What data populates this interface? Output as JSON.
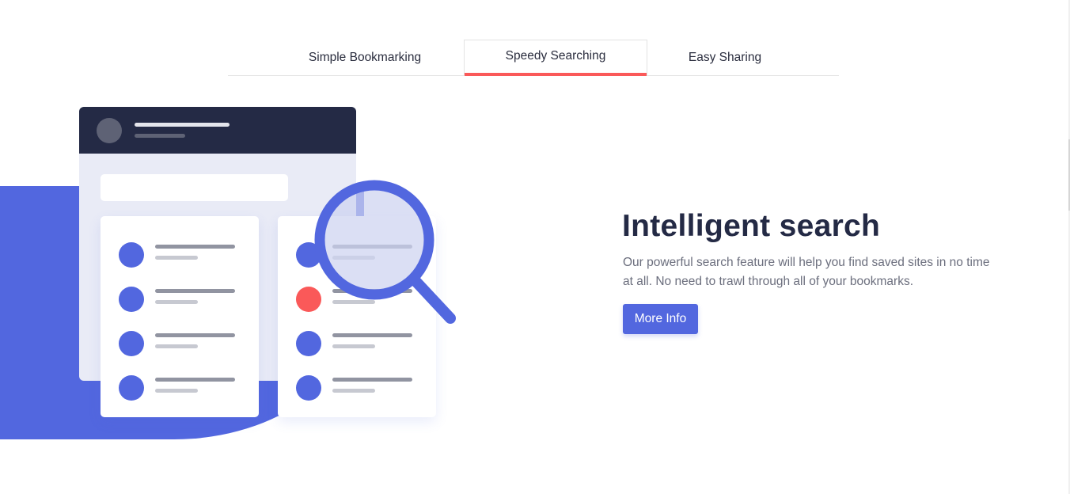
{
  "tabs": [
    {
      "label": "Simple Bookmarking",
      "active": false
    },
    {
      "label": "Speedy Searching",
      "active": true
    },
    {
      "label": "Easy Sharing",
      "active": false
    }
  ],
  "feature": {
    "heading": "Intelligent search",
    "description": "Our powerful search feature will help you find saved sites in no time at all. No need to trawl through all of your bookmarks.",
    "button_label": "More Info"
  },
  "colors": {
    "accent_blue": "#5267df",
    "accent_red": "#fa5959",
    "dark_navy": "#242a45",
    "body_text": "#6b6e7d"
  },
  "illustration": {
    "icons": [
      "magnifying-glass-icon",
      "avatar-icon"
    ]
  }
}
